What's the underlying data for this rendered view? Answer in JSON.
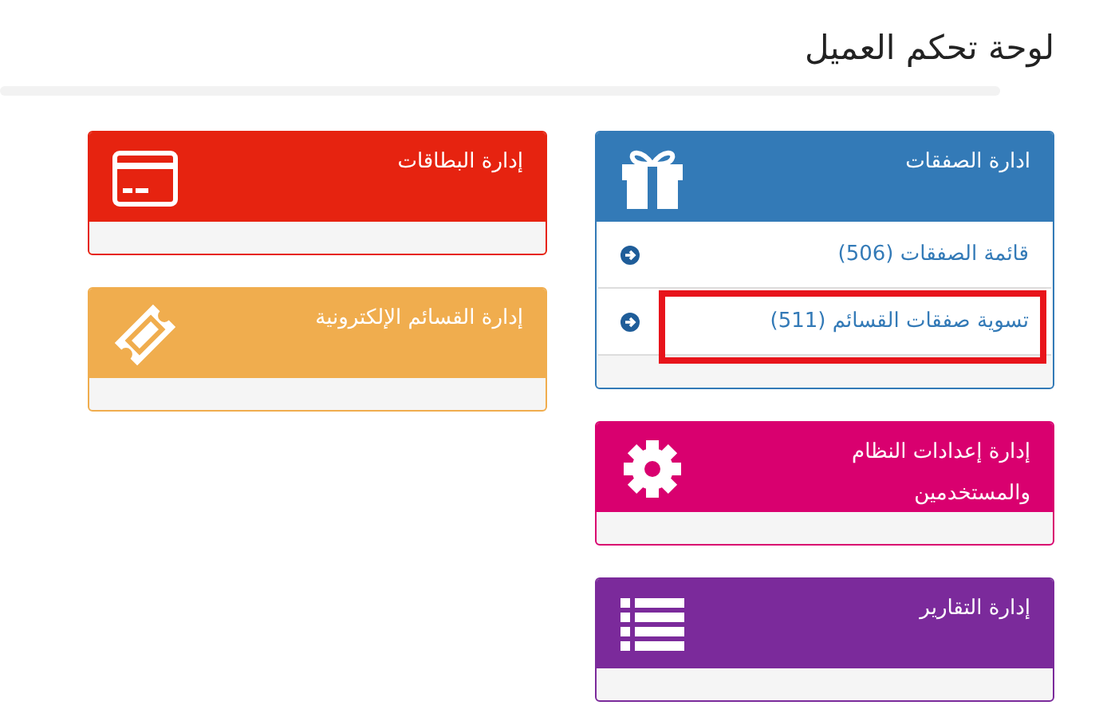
{
  "page": {
    "title": "لوحة تحكم العميل"
  },
  "columns": [
    {
      "cards": [
        {
          "title": "ادارة الصفقات",
          "color": "#337ab7",
          "kind": "gift",
          "items": [
            {
              "label": "قائمة الصفقات (506)",
              "highlighted": false
            },
            {
              "label": "تسوية صفقات القسائم (511)",
              "highlighted": true
            }
          ]
        },
        {
          "title": "إدارة إعدادات النظام والمستخدمين",
          "color": "#d9006f",
          "kind": "gear"
        },
        {
          "title": "إدارة التقارير",
          "color": "#7b2a9b",
          "kind": "list"
        }
      ]
    },
    {
      "cards": [
        {
          "title": "إدارة البطاقات",
          "color": "#e62310",
          "kind": "card"
        },
        {
          "title": "إدارة القسائم الإلكترونية",
          "color": "#f0ad4e",
          "kind": "ticket"
        }
      ]
    }
  ]
}
